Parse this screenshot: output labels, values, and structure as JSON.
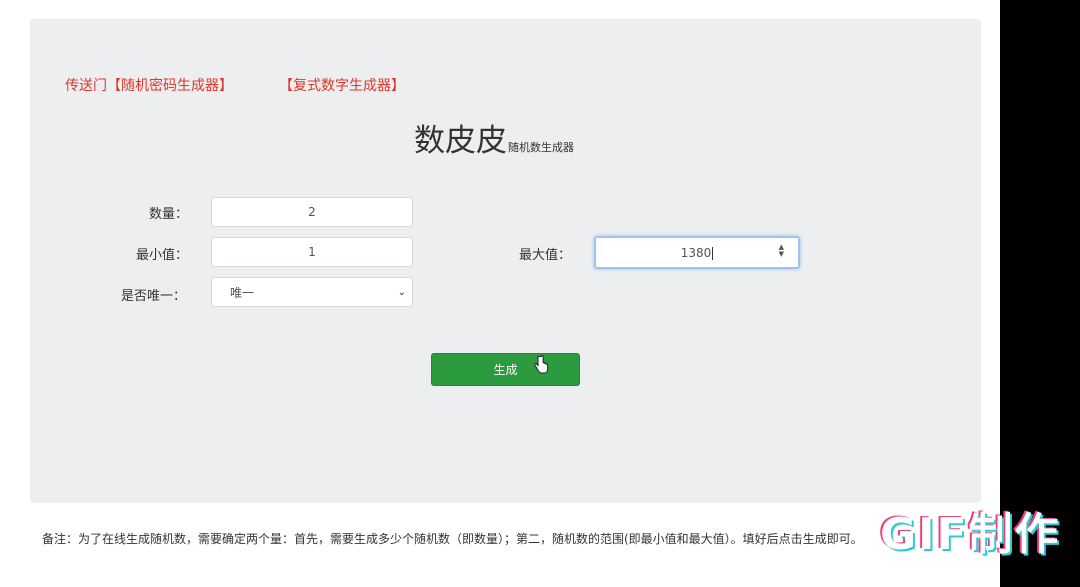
{
  "links": {
    "portal": "传送门【随机密码生成器】",
    "multi": "【复式数字生成器】"
  },
  "title": {
    "main": "数皮皮",
    "sub": "随机数生成器"
  },
  "form": {
    "count_label": "数量：",
    "count_value": "2",
    "min_label": "最小值：",
    "min_value": "1",
    "max_label": "最大值：",
    "max_value": "1380",
    "unique_label": "是否唯一：",
    "unique_value": "唯一"
  },
  "generate_button": "生成",
  "note": "备注：为了在线生成随机数，需要确定两个量：首先，需要生成多少个随机数（即数量）；第二，随机数的范围(即最小值和最大值）。填好后点击生成即可。",
  "watermark": "GIF制作",
  "colors": {
    "accent_red": "#e0362b",
    "button_green": "#2c9a3f",
    "panel_bg": "#eceef0"
  },
  "icons": {
    "select_arrow": "chevron-down-icon",
    "number_spinner": "spinner-icon",
    "cursor": "hand-pointer-icon"
  }
}
